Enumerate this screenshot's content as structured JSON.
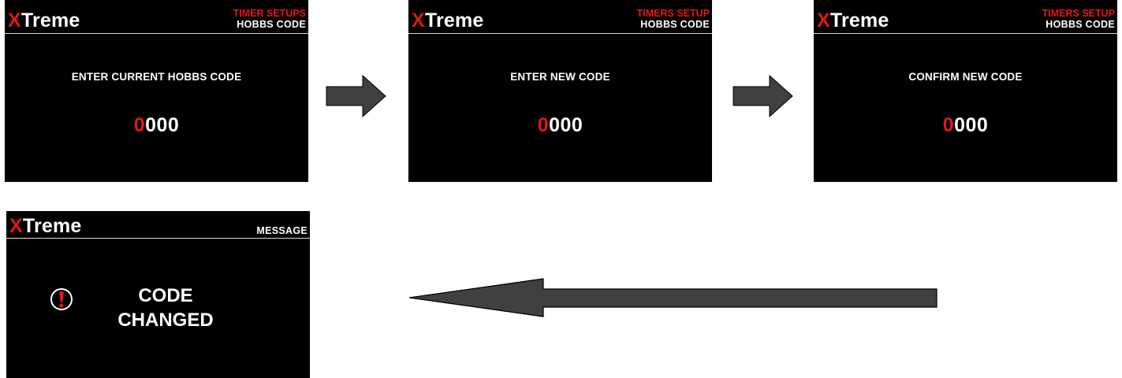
{
  "brand": {
    "x": "X",
    "rest": "Treme"
  },
  "screens": [
    {
      "header_top": "TIMER SETUPS",
      "header_bottom": "HOBBS CODE",
      "prompt": "ENTER CURRENT HOBBS CODE",
      "code_cursor": "0",
      "code_rest": "000"
    },
    {
      "header_top": "TIMERS SETUP",
      "header_bottom": "HOBBS CODE",
      "prompt": "ENTER NEW CODE",
      "code_cursor": "0",
      "code_rest": "000"
    },
    {
      "header_top": "TIMERS SETUP",
      "header_bottom": "HOBBS CODE",
      "prompt": "CONFIRM NEW CODE",
      "code_cursor": "0",
      "code_rest": "000"
    }
  ],
  "message": {
    "header": "MESSAGE",
    "line1": "CODE",
    "line2": "CHANGED",
    "icon": "alert-icon"
  },
  "arrows": [
    "arrow-right",
    "arrow-right",
    "arrow-left"
  ],
  "colors": {
    "accent": "#e01818",
    "screen_bg": "#000000",
    "arrow_fill": "#404040"
  }
}
